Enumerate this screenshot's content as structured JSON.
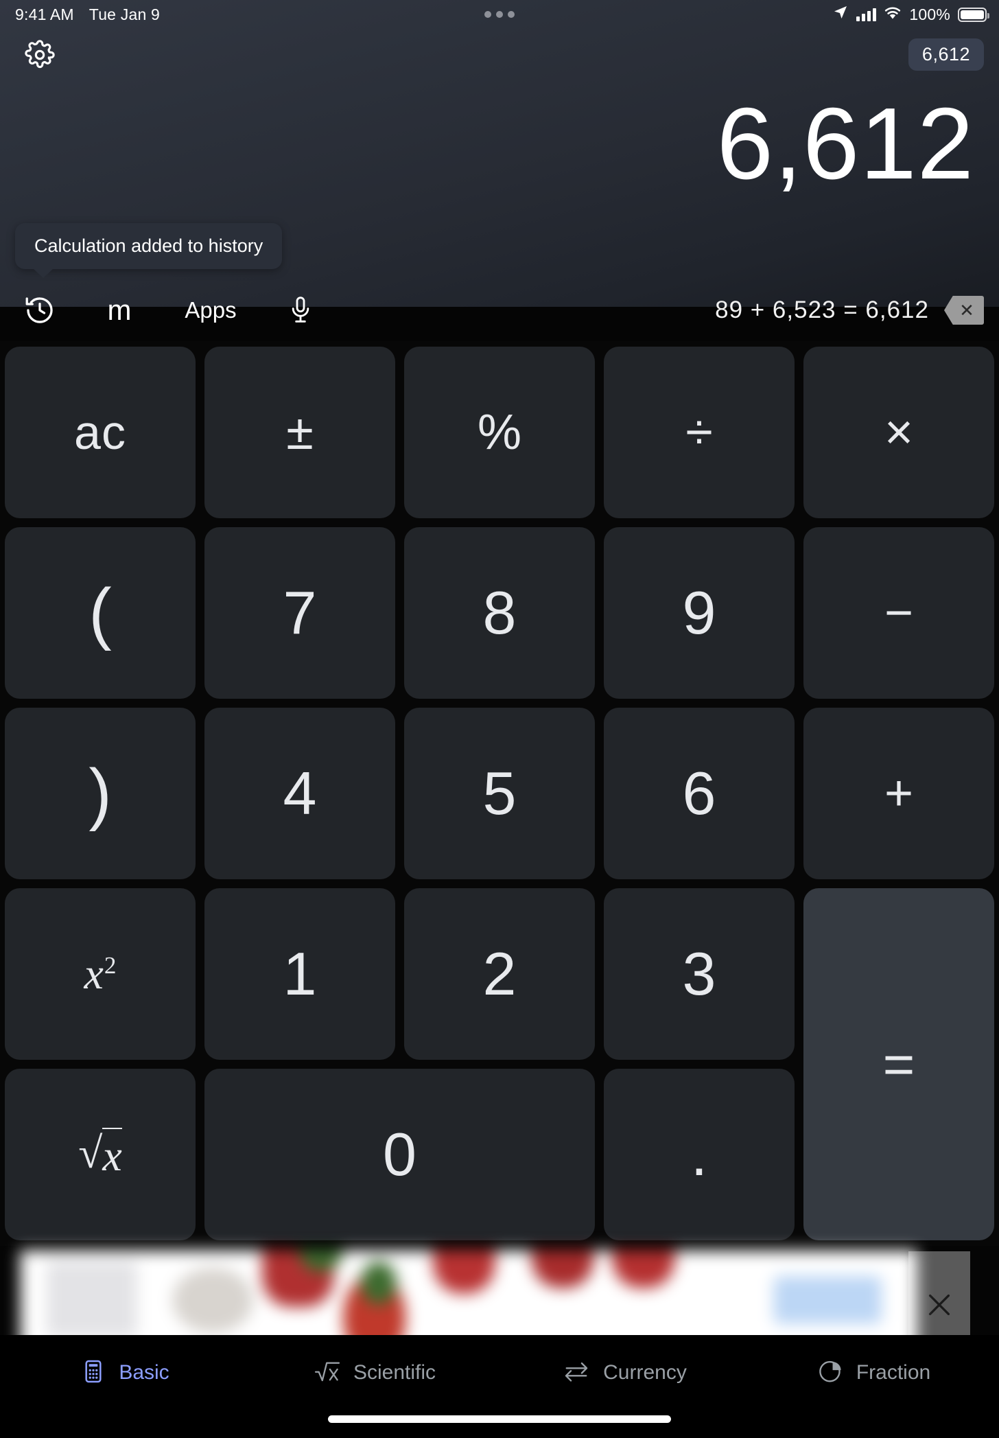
{
  "status_bar": {
    "time": "9:41 AM",
    "date": "Tue Jan 9",
    "battery_percent": "100%",
    "icons": [
      "location-arrow-icon",
      "cellular-signal-icon",
      "wifi-icon",
      "battery-icon"
    ],
    "center_icon": "three-dots-icon"
  },
  "header": {
    "settings_icon": "gear-icon",
    "memory_badge": "6,612"
  },
  "display": {
    "result": "6,612"
  },
  "toast": {
    "message": "Calculation added to history"
  },
  "toolbar": {
    "history_icon": "history-clock-icon",
    "memory_label": "m",
    "apps_label": "Apps",
    "mic_icon": "microphone-icon",
    "expression": "89 + 6,523 = 6,612",
    "backspace_icon": "backspace-icon"
  },
  "keypad": {
    "rows": [
      [
        {
          "label": "ac",
          "name": "key-all-clear",
          "cls": "ac"
        },
        {
          "label": "±",
          "name": "key-plus-minus",
          "cls": "op"
        },
        {
          "label": "%",
          "name": "key-percent",
          "cls": "op"
        },
        {
          "label": "÷",
          "name": "key-divide",
          "cls": "op"
        },
        {
          "label": "×",
          "name": "key-multiply",
          "cls": "op"
        }
      ],
      [
        {
          "label": "(",
          "name": "key-open-paren",
          "cls": "paren"
        },
        {
          "label": "7",
          "name": "key-7",
          "cls": "num"
        },
        {
          "label": "8",
          "name": "key-8",
          "cls": "num"
        },
        {
          "label": "9",
          "name": "key-9",
          "cls": "num"
        },
        {
          "label": "−",
          "name": "key-minus",
          "cls": "op"
        }
      ],
      [
        {
          "label": ")",
          "name": "key-close-paren",
          "cls": "paren"
        },
        {
          "label": "4",
          "name": "key-4",
          "cls": "num"
        },
        {
          "label": "5",
          "name": "key-5",
          "cls": "num"
        },
        {
          "label": "6",
          "name": "key-6",
          "cls": "num"
        },
        {
          "label": "+",
          "name": "key-plus",
          "cls": "op"
        }
      ],
      [
        {
          "label": "x²",
          "name": "key-square",
          "cls": "sci"
        },
        {
          "label": "1",
          "name": "key-1",
          "cls": "num"
        },
        {
          "label": "2",
          "name": "key-2",
          "cls": "num"
        },
        {
          "label": "3",
          "name": "key-3",
          "cls": "num"
        },
        {
          "label": "=",
          "name": "key-equals",
          "cls": "eq"
        }
      ],
      [
        {
          "label": "√x",
          "name": "key-square-root",
          "cls": "sci"
        },
        {
          "label": "0",
          "name": "key-0",
          "cls": "num zero"
        },
        {
          "label": ".",
          "name": "key-decimal",
          "cls": "dot"
        }
      ]
    ]
  },
  "ad": {
    "close_icon": "close-icon"
  },
  "tabbar": {
    "tabs": [
      {
        "label": "Basic",
        "icon": "calculator-icon",
        "active": true
      },
      {
        "label": "Scientific",
        "icon": "square-root-icon",
        "active": false
      },
      {
        "label": "Currency",
        "icon": "swap-arrows-icon",
        "active": false
      },
      {
        "label": "Fraction",
        "icon": "pie-chart-icon",
        "active": false
      }
    ]
  },
  "colors": {
    "accent": "#8c9eff",
    "key_bg": "#222529",
    "equals_bg": "#353a41",
    "panel_top": "#323742",
    "panel_bottom": "#191c22"
  }
}
